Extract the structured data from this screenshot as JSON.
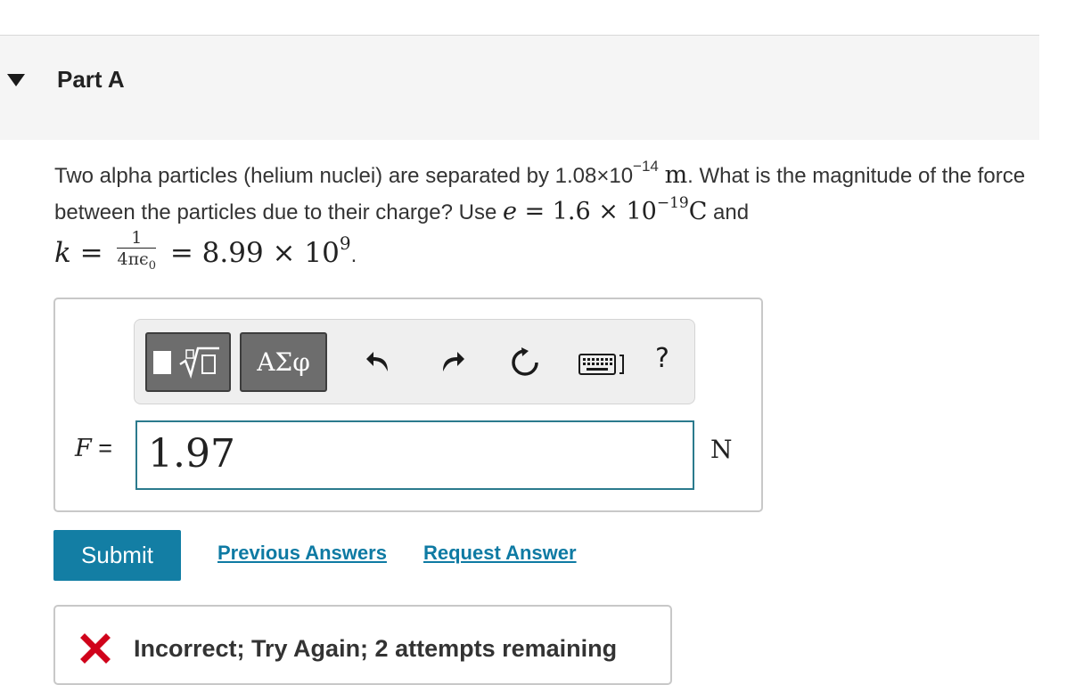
{
  "part": {
    "title": "Part A"
  },
  "question": {
    "text_1": "Two alpha particles (helium nuclei) are separated by 1.08×10",
    "exp_1": "−14",
    "unit_m": "m",
    "text_2": ". What is the magnitude of the force between the particles due to their charge? Use ",
    "e_expr_lhs": "e",
    "e_expr_rhs": " = 1.6 × 10",
    "e_exp": "−19",
    "e_unit": "C",
    "text_3": " and",
    "k_lhs": "k",
    "k_eq1": " = ",
    "frac_num": "1",
    "frac_den": "4πϵ",
    "frac_den_sub": "0",
    "k_eq2": " = 8.99 × 10",
    "k_exp": "9",
    "text_4": "."
  },
  "toolbar": {
    "greek_label": "ΑΣφ",
    "help_label": "?"
  },
  "answer": {
    "variable": "F",
    "equals": " =",
    "value": "1.97",
    "unit": "N"
  },
  "actions": {
    "submit_label": "Submit",
    "previous_answers_label": "Previous Answers",
    "request_answer_label": "Request Answer"
  },
  "feedback": {
    "text": "Incorrect; Try Again; 2 attempts remaining",
    "status_color": "#d0021b"
  },
  "colors": {
    "accent": "#137ea4",
    "link": "#0e7aa3",
    "input_border": "#2b7a8d"
  }
}
